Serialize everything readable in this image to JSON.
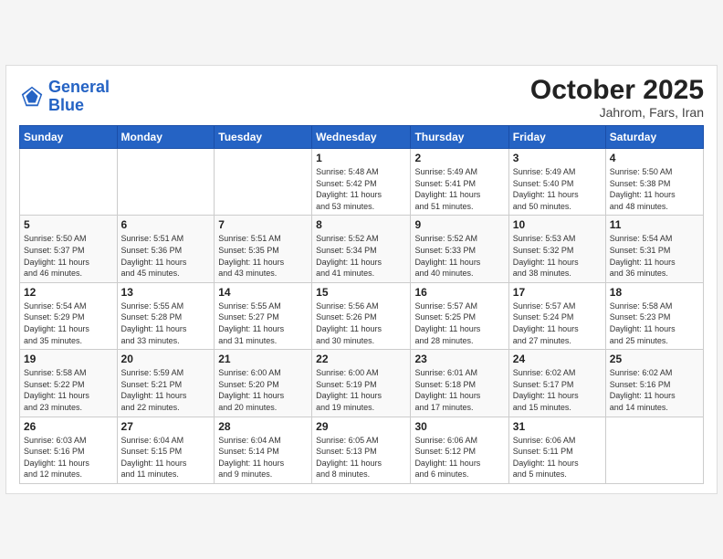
{
  "header": {
    "logo_line1": "General",
    "logo_line2": "Blue",
    "month": "October 2025",
    "location": "Jahrom, Fars, Iran"
  },
  "weekdays": [
    "Sunday",
    "Monday",
    "Tuesday",
    "Wednesday",
    "Thursday",
    "Friday",
    "Saturday"
  ],
  "weeks": [
    [
      {
        "day": "",
        "info": ""
      },
      {
        "day": "",
        "info": ""
      },
      {
        "day": "",
        "info": ""
      },
      {
        "day": "1",
        "info": "Sunrise: 5:48 AM\nSunset: 5:42 PM\nDaylight: 11 hours\nand 53 minutes."
      },
      {
        "day": "2",
        "info": "Sunrise: 5:49 AM\nSunset: 5:41 PM\nDaylight: 11 hours\nand 51 minutes."
      },
      {
        "day": "3",
        "info": "Sunrise: 5:49 AM\nSunset: 5:40 PM\nDaylight: 11 hours\nand 50 minutes."
      },
      {
        "day": "4",
        "info": "Sunrise: 5:50 AM\nSunset: 5:38 PM\nDaylight: 11 hours\nand 48 minutes."
      }
    ],
    [
      {
        "day": "5",
        "info": "Sunrise: 5:50 AM\nSunset: 5:37 PM\nDaylight: 11 hours\nand 46 minutes."
      },
      {
        "day": "6",
        "info": "Sunrise: 5:51 AM\nSunset: 5:36 PM\nDaylight: 11 hours\nand 45 minutes."
      },
      {
        "day": "7",
        "info": "Sunrise: 5:51 AM\nSunset: 5:35 PM\nDaylight: 11 hours\nand 43 minutes."
      },
      {
        "day": "8",
        "info": "Sunrise: 5:52 AM\nSunset: 5:34 PM\nDaylight: 11 hours\nand 41 minutes."
      },
      {
        "day": "9",
        "info": "Sunrise: 5:52 AM\nSunset: 5:33 PM\nDaylight: 11 hours\nand 40 minutes."
      },
      {
        "day": "10",
        "info": "Sunrise: 5:53 AM\nSunset: 5:32 PM\nDaylight: 11 hours\nand 38 minutes."
      },
      {
        "day": "11",
        "info": "Sunrise: 5:54 AM\nSunset: 5:31 PM\nDaylight: 11 hours\nand 36 minutes."
      }
    ],
    [
      {
        "day": "12",
        "info": "Sunrise: 5:54 AM\nSunset: 5:29 PM\nDaylight: 11 hours\nand 35 minutes."
      },
      {
        "day": "13",
        "info": "Sunrise: 5:55 AM\nSunset: 5:28 PM\nDaylight: 11 hours\nand 33 minutes."
      },
      {
        "day": "14",
        "info": "Sunrise: 5:55 AM\nSunset: 5:27 PM\nDaylight: 11 hours\nand 31 minutes."
      },
      {
        "day": "15",
        "info": "Sunrise: 5:56 AM\nSunset: 5:26 PM\nDaylight: 11 hours\nand 30 minutes."
      },
      {
        "day": "16",
        "info": "Sunrise: 5:57 AM\nSunset: 5:25 PM\nDaylight: 11 hours\nand 28 minutes."
      },
      {
        "day": "17",
        "info": "Sunrise: 5:57 AM\nSunset: 5:24 PM\nDaylight: 11 hours\nand 27 minutes."
      },
      {
        "day": "18",
        "info": "Sunrise: 5:58 AM\nSunset: 5:23 PM\nDaylight: 11 hours\nand 25 minutes."
      }
    ],
    [
      {
        "day": "19",
        "info": "Sunrise: 5:58 AM\nSunset: 5:22 PM\nDaylight: 11 hours\nand 23 minutes."
      },
      {
        "day": "20",
        "info": "Sunrise: 5:59 AM\nSunset: 5:21 PM\nDaylight: 11 hours\nand 22 minutes."
      },
      {
        "day": "21",
        "info": "Sunrise: 6:00 AM\nSunset: 5:20 PM\nDaylight: 11 hours\nand 20 minutes."
      },
      {
        "day": "22",
        "info": "Sunrise: 6:00 AM\nSunset: 5:19 PM\nDaylight: 11 hours\nand 19 minutes."
      },
      {
        "day": "23",
        "info": "Sunrise: 6:01 AM\nSunset: 5:18 PM\nDaylight: 11 hours\nand 17 minutes."
      },
      {
        "day": "24",
        "info": "Sunrise: 6:02 AM\nSunset: 5:17 PM\nDaylight: 11 hours\nand 15 minutes."
      },
      {
        "day": "25",
        "info": "Sunrise: 6:02 AM\nSunset: 5:16 PM\nDaylight: 11 hours\nand 14 minutes."
      }
    ],
    [
      {
        "day": "26",
        "info": "Sunrise: 6:03 AM\nSunset: 5:16 PM\nDaylight: 11 hours\nand 12 minutes."
      },
      {
        "day": "27",
        "info": "Sunrise: 6:04 AM\nSunset: 5:15 PM\nDaylight: 11 hours\nand 11 minutes."
      },
      {
        "day": "28",
        "info": "Sunrise: 6:04 AM\nSunset: 5:14 PM\nDaylight: 11 hours\nand 9 minutes."
      },
      {
        "day": "29",
        "info": "Sunrise: 6:05 AM\nSunset: 5:13 PM\nDaylight: 11 hours\nand 8 minutes."
      },
      {
        "day": "30",
        "info": "Sunrise: 6:06 AM\nSunset: 5:12 PM\nDaylight: 11 hours\nand 6 minutes."
      },
      {
        "day": "31",
        "info": "Sunrise: 6:06 AM\nSunset: 5:11 PM\nDaylight: 11 hours\nand 5 minutes."
      },
      {
        "day": "",
        "info": ""
      }
    ]
  ]
}
